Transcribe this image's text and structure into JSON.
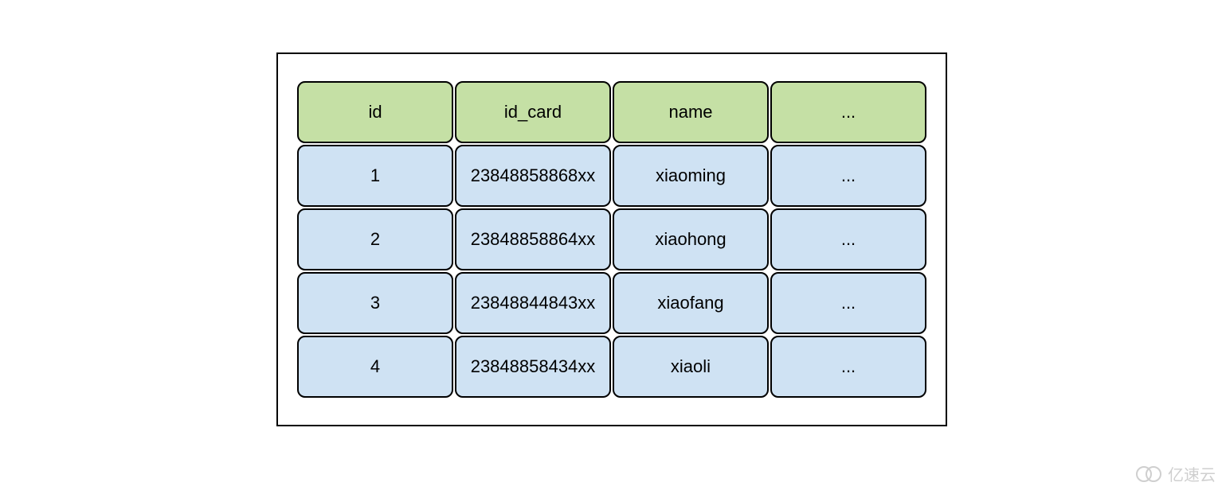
{
  "table": {
    "headers": [
      "id",
      "id_card",
      "name",
      "..."
    ],
    "rows": [
      [
        "1",
        "23848858868xx",
        "xiaoming",
        "..."
      ],
      [
        "2",
        "23848858864xx",
        "xiaohong",
        "..."
      ],
      [
        "3",
        "23848844843xx",
        "xiaofang",
        "..."
      ],
      [
        "4",
        "23848858434xx",
        "xiaoli",
        "..."
      ]
    ]
  },
  "watermark": "亿速云"
}
